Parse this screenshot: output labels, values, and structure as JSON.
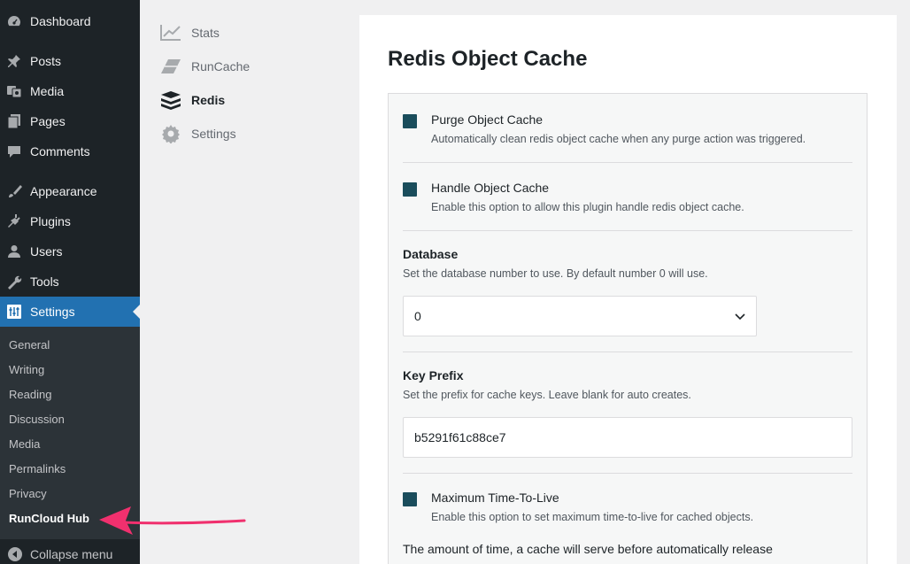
{
  "admin_menu": {
    "items": [
      {
        "label": "Dashboard",
        "icon": "dashboard-icon"
      },
      {
        "label": "Posts",
        "icon": "pin-icon"
      },
      {
        "label": "Media",
        "icon": "media-icon"
      },
      {
        "label": "Pages",
        "icon": "pages-icon"
      },
      {
        "label": "Comments",
        "icon": "comment-icon"
      },
      {
        "label": "Appearance",
        "icon": "brush-icon"
      },
      {
        "label": "Plugins",
        "icon": "plug-icon"
      },
      {
        "label": "Users",
        "icon": "user-icon"
      },
      {
        "label": "Tools",
        "icon": "wrench-icon"
      },
      {
        "label": "Settings",
        "icon": "settings-sliders-icon"
      }
    ],
    "current": "Settings",
    "submenu": [
      "General",
      "Writing",
      "Reading",
      "Discussion",
      "Media",
      "Permalinks",
      "Privacy",
      "RunCloud Hub"
    ],
    "active_submenu": "RunCloud Hub",
    "collapse_label": "Collapse menu"
  },
  "plugin_nav": {
    "items": [
      {
        "label": "Stats",
        "icon": "chart-line-icon"
      },
      {
        "label": "RunCache",
        "icon": "eraser-icon"
      },
      {
        "label": "Redis",
        "icon": "redis-stack-icon"
      },
      {
        "label": "Settings",
        "icon": "gear-icon"
      }
    ],
    "active": "Redis"
  },
  "main": {
    "title": "Redis Object Cache",
    "purge": {
      "label": "Purge Object Cache",
      "description": "Automatically clean redis object cache when any purge action was triggered.",
      "checked": true
    },
    "handle": {
      "label": "Handle Object Cache",
      "description": "Enable this option to allow this plugin handle redis object cache.",
      "checked": true
    },
    "database": {
      "label": "Database",
      "description": "Set the database number to use. By default number 0 will use.",
      "value": "0"
    },
    "key_prefix": {
      "label": "Key Prefix",
      "description": "Set the prefix for cache keys. Leave blank for auto creates.",
      "value": "b5291f61c88ce7"
    },
    "max_ttl": {
      "label": "Maximum Time-To-Live",
      "description": "Enable this option to set maximum time-to-live for cached objects.",
      "checked": true
    },
    "ttl_note": "The amount of time, a cache will serve before automatically release"
  },
  "colors": {
    "sidebar_bg": "#1d2327",
    "accent": "#2271b1",
    "checkbox": "#1a4d5c",
    "arrow": "#f0306e"
  }
}
